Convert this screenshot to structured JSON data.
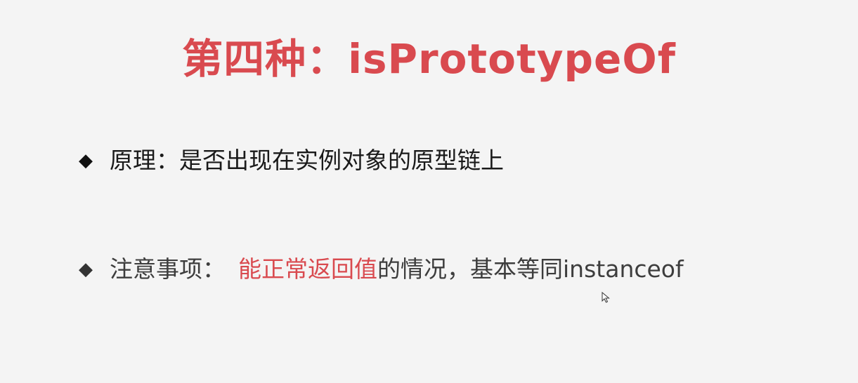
{
  "colors": {
    "accent_red": "#d94a4f",
    "background": "#f4f4f4",
    "text_dark": "#1a1a1a",
    "text_gray": "#3d3d3d"
  },
  "title": "第四种：isPrototypeOf",
  "bullets": [
    {
      "marker": "◆",
      "label": "原理：",
      "text": "是否出现在实例对象的原型链上"
    },
    {
      "marker": "◆",
      "label": "注意事项：",
      "highlight": "能正常返回值",
      "text": "的情况，基本等同instanceof"
    }
  ],
  "icons": {
    "cursor": "mouse-pointer-icon"
  }
}
